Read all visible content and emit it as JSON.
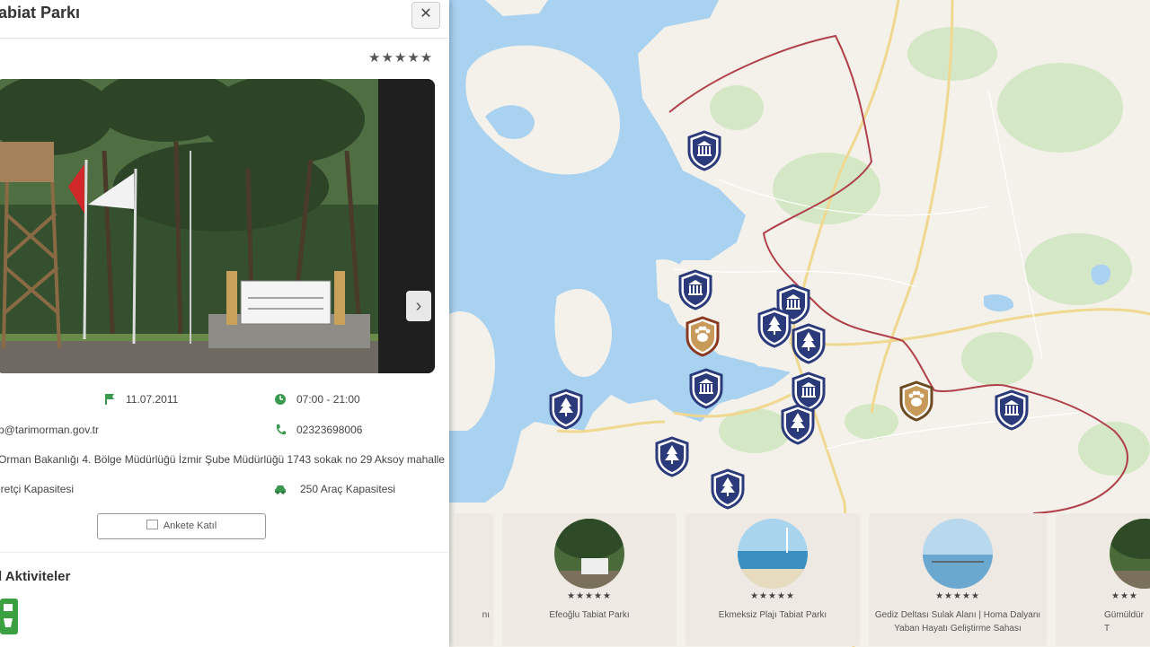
{
  "panel": {
    "title": "abiat Parkı",
    "close_label": "✕",
    "rating": "★★★★★",
    "info": {
      "date": "11.07.2011",
      "hours": "07:00 - 21:00",
      "email": "p@tarimorman.gov.tr",
      "phone": "02323698006",
      "address": "Orman Bakanlığı 4. Bölge Müdürlüğü İzmir Şube Müdürlüğü 1743 sokak no 29 Aksoy mahalle",
      "visitor_capacity": "iretçi Kapasitesi",
      "vehicle_capacity": "250 Araç Kapasitesi"
    },
    "survey_button": "Ankete Katıl",
    "activities_title": "l Aktiviteler"
  },
  "map": {
    "markers": [
      {
        "type": "museum",
        "color": "#2b3a7a"
      },
      {
        "type": "museum",
        "color": "#2b3a7a"
      },
      {
        "type": "museum",
        "color": "#2b3a7a"
      },
      {
        "type": "tree",
        "color": "#2b3a7a"
      },
      {
        "type": "tree",
        "color": "#2b3a7a"
      },
      {
        "type": "tree",
        "color": "#2b3a7a"
      },
      {
        "type": "paw",
        "color": "#8a3a20"
      },
      {
        "type": "museum",
        "color": "#2b3a7a"
      },
      {
        "type": "museum",
        "color": "#2b3a7a"
      },
      {
        "type": "tree",
        "color": "#2b3a7a"
      },
      {
        "type": "tree",
        "color": "#2b3a7a"
      },
      {
        "type": "tree",
        "color": "#2b3a7a"
      },
      {
        "type": "tree",
        "color": "#2b3a7a"
      },
      {
        "type": "paw",
        "color": "#6b4a20"
      },
      {
        "type": "museum",
        "color": "#2b3a7a"
      }
    ]
  },
  "cards": [
    {
      "name": "nı",
      "rating": ""
    },
    {
      "name": "Efeoğlu Tabiat Parkı",
      "rating": "★★★★★"
    },
    {
      "name": "Ekmeksiz Plajı Tabiat Parkı",
      "rating": "★★★★★"
    },
    {
      "name": "Gediz Deltası Sulak Alanı | Homa Dalyanı Yaban Hayatı Geliştirme Sahası",
      "rating": "★★★★★"
    },
    {
      "name": "Gümüldür T",
      "rating": "★★★"
    }
  ],
  "colors": {
    "marker_blue": "#2b3a7a",
    "water": "#a9d1f0",
    "land": "#f3f1ea",
    "park": "#cfe6c0",
    "border": "#b0414a",
    "card_bg": "#efe9e4"
  }
}
